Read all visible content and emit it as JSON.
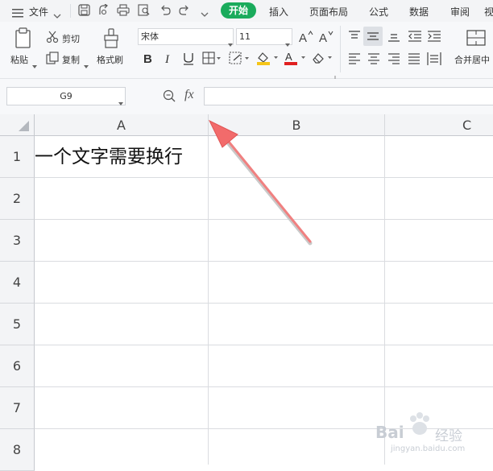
{
  "menubar": {
    "file_label": "文件",
    "tabs": [
      {
        "label": "开始",
        "active": true
      },
      {
        "label": "插入",
        "active": false
      },
      {
        "label": "页面布局",
        "active": false
      },
      {
        "label": "公式",
        "active": false
      },
      {
        "label": "数据",
        "active": false
      },
      {
        "label": "审阅",
        "active": false
      },
      {
        "label": "视",
        "active": false
      }
    ],
    "accent_color": "#1aab5c"
  },
  "ribbon": {
    "paste_label": "粘贴",
    "cut_label": "剪切",
    "copy_label": "复制",
    "format_painter_label": "格式刷",
    "font_name": "宋体",
    "font_size": "11",
    "font_color": "#e02020",
    "fill_color": "#f5c518",
    "merge_label": "合并居中"
  },
  "formula_bar": {
    "name_box": "G9",
    "fx_label": "fx",
    "formula_value": ""
  },
  "sheet": {
    "columns": [
      "A",
      "B",
      "C"
    ],
    "rows": [
      "1",
      "2",
      "3",
      "4",
      "5",
      "6",
      "7",
      "8"
    ],
    "cells": {
      "A1": "一个文字需要换行"
    }
  },
  "watermark": {
    "brand": "Bai",
    "brand_cn": "经验",
    "url": "jingyan.baidu.com"
  },
  "annotation": {
    "arrow_color": "#f08080"
  }
}
